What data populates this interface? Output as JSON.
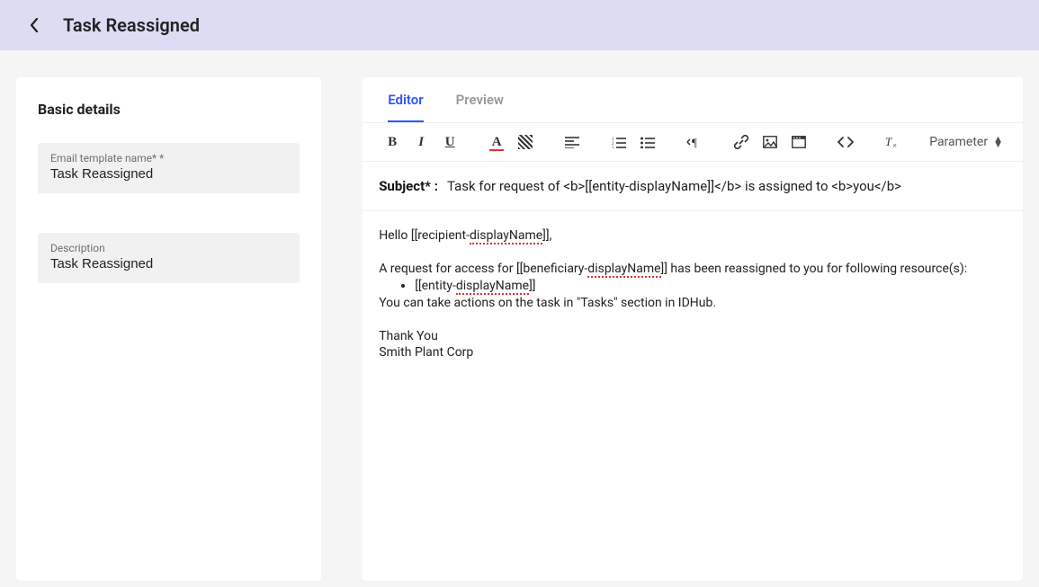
{
  "header": {
    "title": "Task Reassigned"
  },
  "left": {
    "section_title": "Basic details",
    "name_label": "Email template name* *",
    "name_value": "Task Reassigned",
    "desc_label": "Description",
    "desc_value": "Task Reassigned"
  },
  "tabs": {
    "editor": "Editor",
    "preview": "Preview"
  },
  "toolbar": {
    "parameter": "Parameter"
  },
  "subject": {
    "label": "Subject* :",
    "value": "Task for request of <b>[[entity-displayName]]</b> is assigned to <b>you</b>"
  },
  "body": {
    "line1a": "Hello [[recipient-",
    "line1b": "displayName",
    "line1c": "]],",
    "line2a": "A request for access for [[beneficiary-",
    "line2b": "displayName",
    "line2c": "]] has been reassigned to you for following resource(s):",
    "bullet_a": "[[entity-",
    "bullet_b": "displayName",
    "bullet_c": "]]",
    "line3": "You can take actions on the task in \"Tasks\" section in IDHub.",
    "line4": "Thank You",
    "line5": "Smith Plant Corp"
  }
}
